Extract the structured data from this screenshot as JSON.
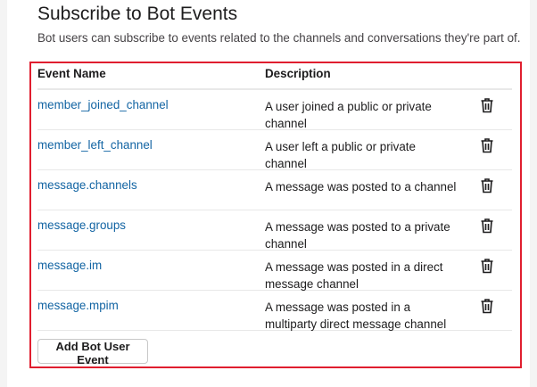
{
  "section": {
    "title": "Subscribe to Bot Events",
    "description": "Bot users can subscribe to events related to the channels and conversations they're part of."
  },
  "table": {
    "headers": {
      "event_name": "Event Name",
      "description": "Description"
    },
    "rows": [
      {
        "name": "member_joined_channel",
        "description": "A user joined a public or private channel"
      },
      {
        "name": "member_left_channel",
        "description": "A user left a public or private channel"
      },
      {
        "name": "message.channels",
        "description": "A message was posted to a channel"
      },
      {
        "name": "message.groups",
        "description": "A message was posted to a private channel"
      },
      {
        "name": "message.im",
        "description": "A message was posted in a direct message channel"
      },
      {
        "name": "message.mpim",
        "description": "A message was posted in a multiparty direct message channel"
      }
    ],
    "row_icon": "trash-icon"
  },
  "add_button_label": "Add Bot User Event",
  "colors": {
    "link": "#1264a3",
    "highlight_border": "#e01e2f"
  }
}
